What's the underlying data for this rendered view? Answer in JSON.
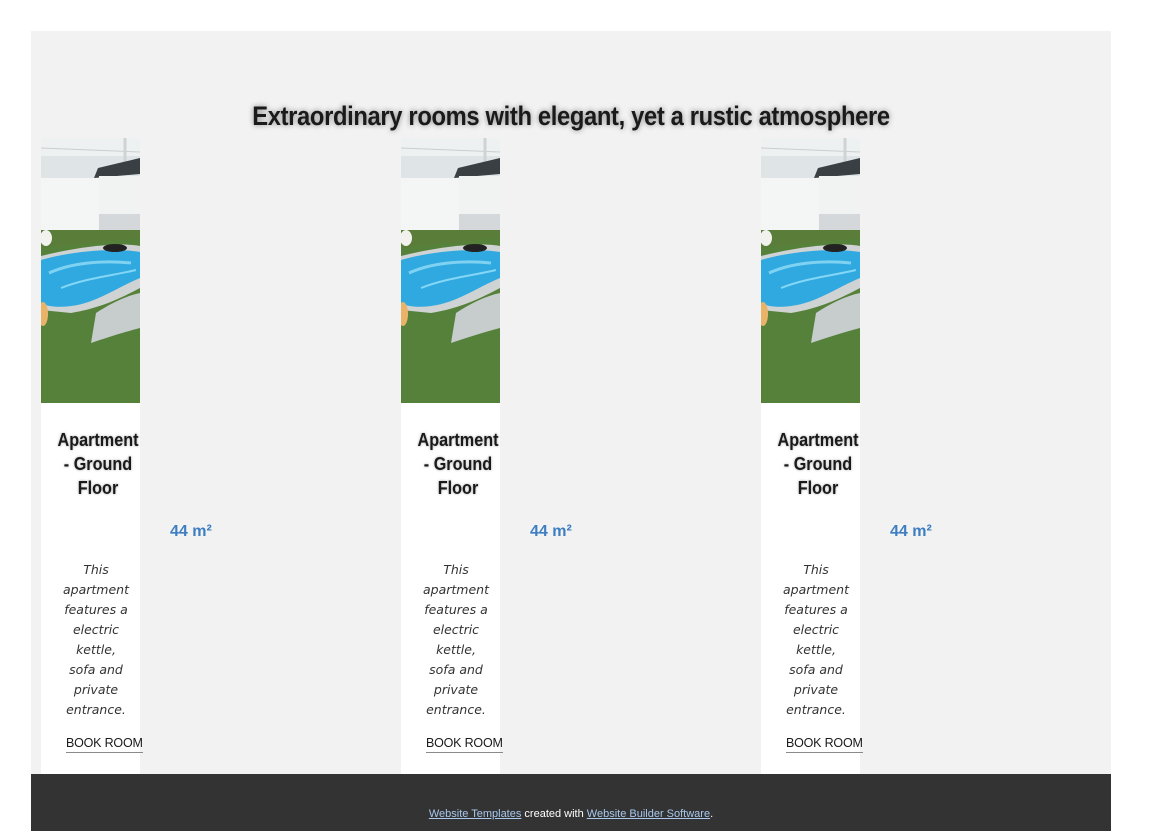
{
  "section": {
    "heading": "Extraordinary rooms with elegant, yet a rustic atmosphere"
  },
  "rooms": [
    {
      "title_lines": [
        "Apartment",
        "- Ground",
        "Floor"
      ],
      "size": "44 m²",
      "description_lines": [
        "This",
        "apartment",
        "features a",
        "electric",
        "kettle,",
        "sofa and",
        "private",
        "entrance."
      ],
      "button_label": "BOOK ROOM"
    },
    {
      "title_lines": [
        "Apartment",
        "- Ground",
        "Floor"
      ],
      "size": "44 m²",
      "description_lines": [
        "This",
        "apartment",
        "features a",
        "electric",
        "kettle,",
        "sofa and",
        "private",
        "entrance."
      ],
      "button_label": "BOOK ROOM"
    },
    {
      "title_lines": [
        "Apartment",
        "- Ground",
        "Floor"
      ],
      "size": "44 m²",
      "description_lines": [
        "This",
        "apartment",
        "features a",
        "electric",
        "kettle,",
        "sofa and",
        "private",
        "entrance."
      ],
      "button_label": "BOOK ROOM"
    }
  ],
  "footer": {
    "link1": "Website Templates",
    "middle": " created with ",
    "link2": "Website Builder Software",
    "end": "."
  },
  "colors": {
    "size_accent": "#3d7dc2",
    "footer_bg": "#333333",
    "section_bg": "#f2f2f2"
  }
}
